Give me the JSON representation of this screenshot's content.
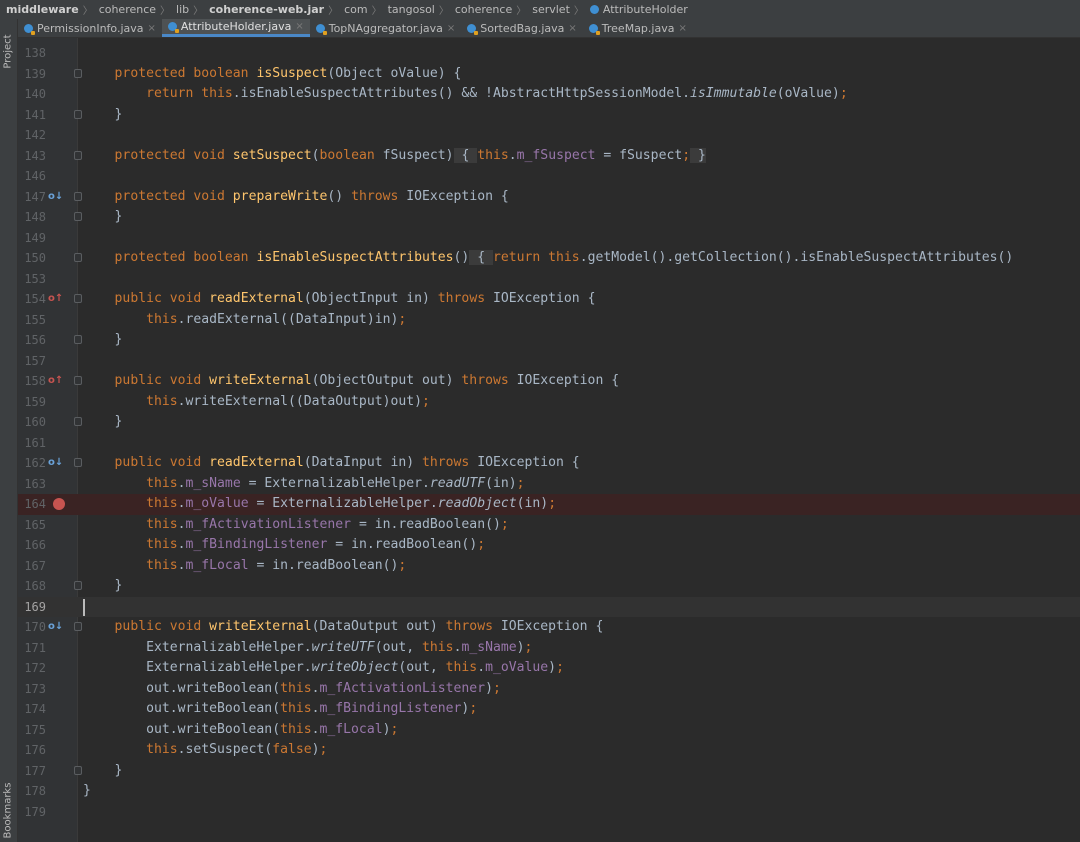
{
  "breadcrumb": [
    {
      "label": "middleware",
      "bold": true
    },
    {
      "label": "coherence",
      "bold": false
    },
    {
      "label": "lib",
      "bold": false
    },
    {
      "label": "coherence-web.jar",
      "bold": true
    },
    {
      "label": "com",
      "bold": false
    },
    {
      "label": "tangosol",
      "bold": false
    },
    {
      "label": "coherence",
      "bold": false
    },
    {
      "label": "servlet",
      "bold": false
    },
    {
      "label": "AttributeHolder",
      "bold": false,
      "icon": "class-icon"
    }
  ],
  "side_labels": {
    "project": "Project",
    "bookmarks": "Bookmarks"
  },
  "tabs": [
    {
      "label": "PermissionInfo.java",
      "active": false,
      "close": "×"
    },
    {
      "label": "AttributeHolder.java",
      "active": true,
      "close": "×"
    },
    {
      "label": "TopNAggregator.java",
      "active": false,
      "close": "×"
    },
    {
      "label": "SortedBag.java",
      "active": false,
      "close": "×"
    },
    {
      "label": "TreeMap.java",
      "active": false,
      "close": "×"
    }
  ],
  "colors": {
    "keyword": "#cc7832",
    "function": "#ffc66d",
    "field": "#9876aa",
    "text": "#a9b7c6",
    "breakpoint": "#c75450"
  },
  "code_lines": [
    {
      "num": "138",
      "tokens": []
    },
    {
      "num": "139",
      "fold": true,
      "tokens": [
        [
          "",
          "    "
        ],
        [
          "kw",
          "protected boolean "
        ],
        [
          "fn",
          "isSuspect"
        ],
        [
          "",
          "(Object oValue) {"
        ]
      ]
    },
    {
      "num": "140",
      "tokens": [
        [
          "",
          "        "
        ],
        [
          "kw",
          "return this"
        ],
        [
          "",
          ".isEnableSuspectAttributes() && !AbstractHttpSessionModel."
        ],
        [
          "it",
          "isImmutable"
        ],
        [
          "",
          "(oValue)"
        ],
        [
          "kw",
          ";"
        ]
      ]
    },
    {
      "num": "141",
      "fold": true,
      "tokens": [
        [
          "",
          "    }"
        ]
      ]
    },
    {
      "num": "142",
      "tokens": []
    },
    {
      "num": "143",
      "fold": true,
      "tokens": [
        [
          "",
          "    "
        ],
        [
          "kw",
          "protected void "
        ],
        [
          "fn",
          "setSuspect"
        ],
        [
          "",
          "("
        ],
        [
          "kw",
          "boolean "
        ],
        [
          "",
          "fSuspect)"
        ],
        [
          "fold-bg",
          " { "
        ],
        [
          "kw",
          "this"
        ],
        [
          "",
          "."
        ],
        [
          "fld",
          "m_fSuspect"
        ],
        [
          "",
          " = fSuspect"
        ],
        [
          "kw",
          ";"
        ],
        [
          "fold-bg",
          " }"
        ]
      ]
    },
    {
      "num": "146",
      "tokens": []
    },
    {
      "num": "147",
      "gicon": "o↓",
      "gicon_kind": "impl",
      "fold": true,
      "tokens": [
        [
          "",
          "    "
        ],
        [
          "kw",
          "protected void "
        ],
        [
          "fn",
          "prepareWrite"
        ],
        [
          "",
          "() "
        ],
        [
          "kw",
          "throws "
        ],
        [
          "",
          "IOException {"
        ]
      ]
    },
    {
      "num": "148",
      "fold": true,
      "tokens": [
        [
          "",
          "    }"
        ]
      ]
    },
    {
      "num": "149",
      "tokens": []
    },
    {
      "num": "150",
      "fold": true,
      "tokens": [
        [
          "",
          "    "
        ],
        [
          "kw",
          "protected boolean "
        ],
        [
          "fn",
          "isEnableSuspectAttributes"
        ],
        [
          "",
          "()"
        ],
        [
          "fold-bg",
          " { "
        ],
        [
          "kw",
          "return this"
        ],
        [
          "",
          ".getModel().getCollection().isEnableSuspectAttributes()"
        ]
      ]
    },
    {
      "num": "153",
      "tokens": []
    },
    {
      "num": "154",
      "gicon": "o↑",
      "gicon_kind": "over",
      "fold": true,
      "tokens": [
        [
          "",
          "    "
        ],
        [
          "kw",
          "public void "
        ],
        [
          "fn",
          "readExternal"
        ],
        [
          "",
          "(ObjectInput in) "
        ],
        [
          "kw",
          "throws "
        ],
        [
          "",
          "IOException {"
        ]
      ]
    },
    {
      "num": "155",
      "tokens": [
        [
          "",
          "        "
        ],
        [
          "kw",
          "this"
        ],
        [
          "",
          ".readExternal((DataInput)in)"
        ],
        [
          "kw",
          ";"
        ]
      ]
    },
    {
      "num": "156",
      "fold": true,
      "tokens": [
        [
          "",
          "    }"
        ]
      ]
    },
    {
      "num": "157",
      "tokens": []
    },
    {
      "num": "158",
      "gicon": "o↑",
      "gicon_kind": "over",
      "fold": true,
      "tokens": [
        [
          "",
          "    "
        ],
        [
          "kw",
          "public void "
        ],
        [
          "fn",
          "writeExternal"
        ],
        [
          "",
          "(ObjectOutput out) "
        ],
        [
          "kw",
          "throws "
        ],
        [
          "",
          "IOException {"
        ]
      ]
    },
    {
      "num": "159",
      "tokens": [
        [
          "",
          "        "
        ],
        [
          "kw",
          "this"
        ],
        [
          "",
          ".writeExternal((DataOutput)out)"
        ],
        [
          "kw",
          ";"
        ]
      ]
    },
    {
      "num": "160",
      "fold": true,
      "tokens": [
        [
          "",
          "    }"
        ]
      ]
    },
    {
      "num": "161",
      "tokens": []
    },
    {
      "num": "162",
      "gicon": "o↓",
      "gicon_kind": "impl",
      "fold": true,
      "tokens": [
        [
          "",
          "    "
        ],
        [
          "kw",
          "public void "
        ],
        [
          "fn",
          "readExternal"
        ],
        [
          "",
          "(DataInput in) "
        ],
        [
          "kw",
          "throws "
        ],
        [
          "",
          "IOException {"
        ]
      ]
    },
    {
      "num": "163",
      "tokens": [
        [
          "",
          "        "
        ],
        [
          "kw",
          "this"
        ],
        [
          "",
          "."
        ],
        [
          "fld",
          "m_sName"
        ],
        [
          "",
          " = ExternalizableHelper."
        ],
        [
          "it",
          "readUTF"
        ],
        [
          "",
          "(in)"
        ],
        [
          "kw",
          ";"
        ]
      ]
    },
    {
      "num": "164",
      "breakpoint": true,
      "tokens": [
        [
          "",
          "        "
        ],
        [
          "kw",
          "this"
        ],
        [
          "",
          "."
        ],
        [
          "fld",
          "m_oValue"
        ],
        [
          "",
          " = ExternalizableHelper."
        ],
        [
          "it",
          "readObject"
        ],
        [
          "",
          "(in)"
        ],
        [
          "kw",
          ";"
        ]
      ]
    },
    {
      "num": "165",
      "tokens": [
        [
          "",
          "        "
        ],
        [
          "kw",
          "this"
        ],
        [
          "",
          "."
        ],
        [
          "fld",
          "m_fActivationListener"
        ],
        [
          "",
          " = in.readBoolean()"
        ],
        [
          "kw",
          ";"
        ]
      ]
    },
    {
      "num": "166",
      "tokens": [
        [
          "",
          "        "
        ],
        [
          "kw",
          "this"
        ],
        [
          "",
          "."
        ],
        [
          "fld",
          "m_fBindingListener"
        ],
        [
          "",
          " = in.readBoolean()"
        ],
        [
          "kw",
          ";"
        ]
      ]
    },
    {
      "num": "167",
      "tokens": [
        [
          "",
          "        "
        ],
        [
          "kw",
          "this"
        ],
        [
          "",
          "."
        ],
        [
          "fld",
          "m_fLocal"
        ],
        [
          "",
          " = in.readBoolean()"
        ],
        [
          "kw",
          ";"
        ]
      ]
    },
    {
      "num": "168",
      "fold": true,
      "tokens": [
        [
          "",
          "    }"
        ]
      ]
    },
    {
      "num": "169",
      "current": true,
      "tokens": []
    },
    {
      "num": "170",
      "gicon": "o↓",
      "gicon_kind": "impl",
      "fold": true,
      "tokens": [
        [
          "",
          "    "
        ],
        [
          "kw",
          "public void "
        ],
        [
          "fn",
          "writeExternal"
        ],
        [
          "",
          "(DataOutput out) "
        ],
        [
          "kw",
          "throws "
        ],
        [
          "",
          "IOException {"
        ]
      ]
    },
    {
      "num": "171",
      "tokens": [
        [
          "",
          "        ExternalizableHelper."
        ],
        [
          "it",
          "writeUTF"
        ],
        [
          "",
          "(out, "
        ],
        [
          "kw",
          "this"
        ],
        [
          "",
          "."
        ],
        [
          "fld",
          "m_sName"
        ],
        [
          "",
          ")"
        ],
        [
          "kw",
          ";"
        ]
      ]
    },
    {
      "num": "172",
      "tokens": [
        [
          "",
          "        ExternalizableHelper."
        ],
        [
          "it",
          "writeObject"
        ],
        [
          "",
          "(out, "
        ],
        [
          "kw",
          "this"
        ],
        [
          "",
          "."
        ],
        [
          "fld",
          "m_oValue"
        ],
        [
          "",
          ")"
        ],
        [
          "kw",
          ";"
        ]
      ]
    },
    {
      "num": "173",
      "tokens": [
        [
          "",
          "        out.writeBoolean("
        ],
        [
          "kw",
          "this"
        ],
        [
          "",
          "."
        ],
        [
          "fld",
          "m_fActivationListener"
        ],
        [
          "",
          ")"
        ],
        [
          "kw",
          ";"
        ]
      ]
    },
    {
      "num": "174",
      "tokens": [
        [
          "",
          "        out.writeBoolean("
        ],
        [
          "kw",
          "this"
        ],
        [
          "",
          "."
        ],
        [
          "fld",
          "m_fBindingListener"
        ],
        [
          "",
          ")"
        ],
        [
          "kw",
          ";"
        ]
      ]
    },
    {
      "num": "175",
      "tokens": [
        [
          "",
          "        out.writeBoolean("
        ],
        [
          "kw",
          "this"
        ],
        [
          "",
          "."
        ],
        [
          "fld",
          "m_fLocal"
        ],
        [
          "",
          ")"
        ],
        [
          "kw",
          ";"
        ]
      ]
    },
    {
      "num": "176",
      "tokens": [
        [
          "",
          "        "
        ],
        [
          "kw",
          "this"
        ],
        [
          "",
          ".setSuspect("
        ],
        [
          "kw",
          "false"
        ],
        [
          "",
          ")"
        ],
        [
          "kw",
          ";"
        ]
      ]
    },
    {
      "num": "177",
      "fold": true,
      "tokens": [
        [
          "",
          "    }"
        ]
      ]
    },
    {
      "num": "178",
      "tokens": [
        [
          "",
          "}"
        ]
      ]
    },
    {
      "num": "179",
      "tokens": []
    }
  ]
}
